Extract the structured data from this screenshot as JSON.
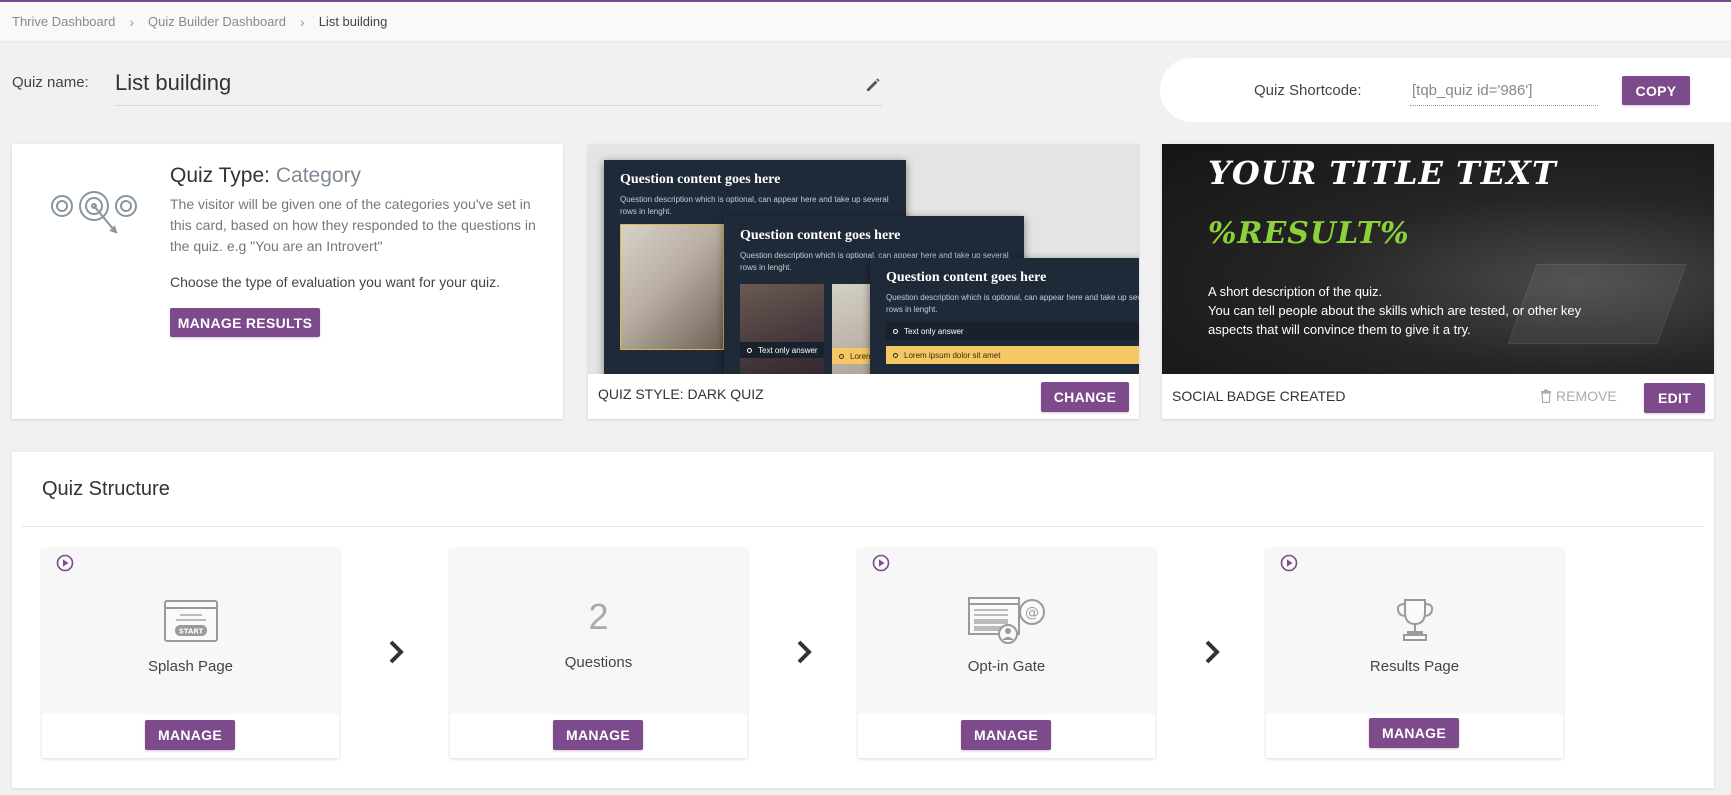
{
  "breadcrumb": {
    "items": [
      "Thrive Dashboard",
      "Quiz Builder Dashboard"
    ],
    "current": "List building",
    "separator": "›"
  },
  "quiz_name": {
    "label": "Quiz name:",
    "value": "List building"
  },
  "shortcode": {
    "label": "Quiz Shortcode:",
    "value": "[tqb_quiz id='986']",
    "copy_label": "COPY"
  },
  "quiz_type": {
    "title_prefix": "Quiz Type:",
    "category": "Category",
    "description": "The visitor will be given one of the categories you've set in this card, based on how they responded to the questions in the quiz. e.g \"You are an Introvert\"",
    "choose_text": "Choose the type of evaluation you want for your quiz.",
    "button_label": "MANAGE RESULTS"
  },
  "quiz_style": {
    "preview": {
      "panels": [
        {
          "title": "Question content goes here",
          "desc": "Question description which is optional, can appear here and take up several rows in lenght."
        },
        {
          "title": "Question content goes here",
          "desc": "Question description which is optional, can appear here and take up several rows in lenght."
        },
        {
          "title": "Question content goes here",
          "desc": "Question description which is optional, can appear here and take up several rows in lenght."
        }
      ],
      "answer_plain": "Text only answer",
      "answer_selected": "Lorem ipsum dolor sit amet",
      "answer_cut": "Lorem"
    },
    "label": "QUIZ STYLE: DARK QUIZ",
    "button_label": "CHANGE"
  },
  "social_badge": {
    "preview": {
      "title": "YOUR TITLE TEXT",
      "result": "%RESULT%",
      "desc_line1": "A short description of the quiz.",
      "desc_line2": "You can tell people about the skills which are tested, or other key aspects that will convince them to give it a try."
    },
    "label": "SOCIAL BADGE CREATED",
    "remove_label": "REMOVE",
    "edit_label": "EDIT"
  },
  "structure": {
    "title": "Quiz Structure",
    "steps": [
      {
        "label": "Splash Page",
        "icon": "splash-start-icon",
        "icon_text": "START",
        "button": "MANAGE"
      },
      {
        "label": "Questions",
        "count": "2",
        "button": "MANAGE"
      },
      {
        "label": "Opt-in Gate",
        "icon": "optin-gate-icon",
        "button": "MANAGE"
      },
      {
        "label": "Results Page",
        "icon": "trophy-icon",
        "button": "MANAGE"
      }
    ]
  },
  "colors": {
    "accent": "#7d4a8c",
    "result_green": "#8bd23a",
    "quiz_panel": "#1f2a38",
    "answer_selected": "#f5c863"
  }
}
